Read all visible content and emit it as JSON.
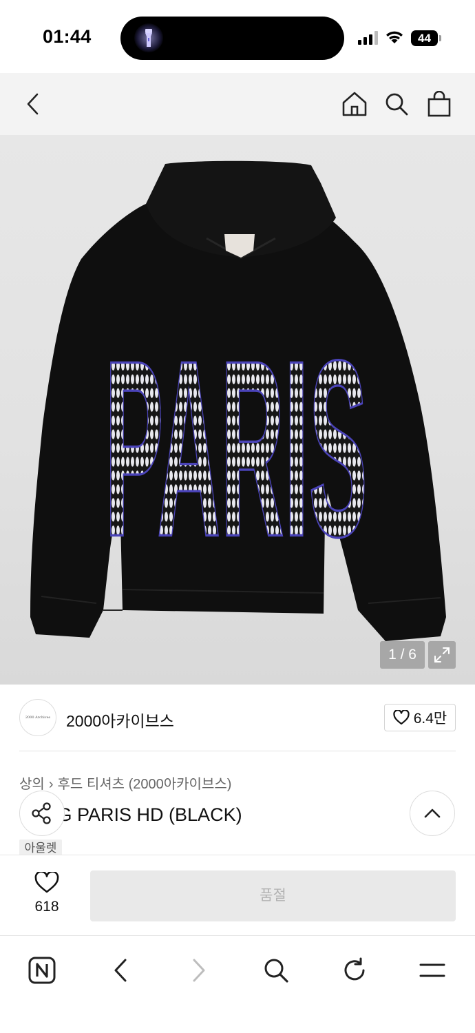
{
  "status_bar": {
    "time": "01:44",
    "battery": "44"
  },
  "product": {
    "image_counter": "1 / 6",
    "artwork_text": "PARIS",
    "brand_name": "2000아카이브스",
    "brand_logo_text": "2000 Archives",
    "likes_short": "6.4만",
    "breadcrumb": [
      "상의",
      "후드 티셔츠 (2000아카이브스)"
    ],
    "title": "LONG PARIS HD (BLACK)",
    "badge": "아울렛"
  },
  "purchase_bar": {
    "heart_count": "618",
    "soldout_label": "품절"
  },
  "colors": {
    "soldout_bg": "#e9e9e9",
    "soldout_text": "#b3b3b3",
    "hoodie": "#101010",
    "rhinestone_outline": "#4a43b8"
  }
}
